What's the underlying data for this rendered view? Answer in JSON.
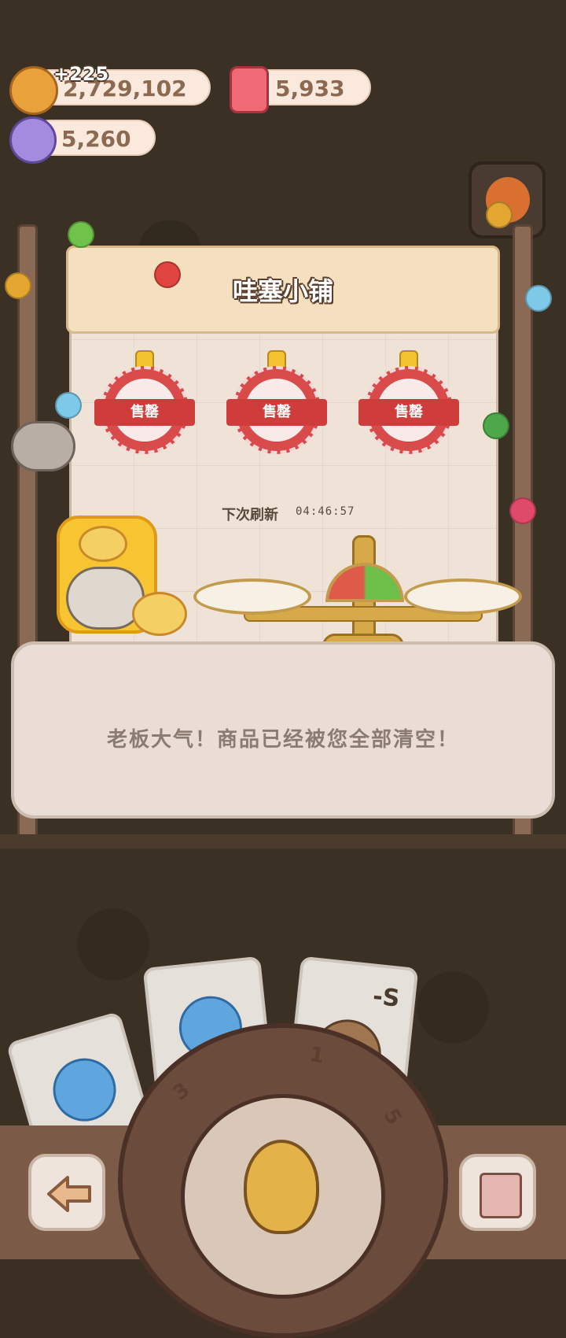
{
  "currencies": {
    "cookie": {
      "value": "2,729,102",
      "gain": "+225",
      "icon": "cookie-icon"
    },
    "candle": {
      "value": "5,933",
      "icon": "candle-icon"
    },
    "candy": {
      "value": "5,260",
      "icon": "candy-icon"
    }
  },
  "shop": {
    "title": "哇塞小铺",
    "slots": [
      {
        "status": "售罄"
      },
      {
        "status": "售罄"
      },
      {
        "status": "售罄"
      }
    ],
    "refresh_label": "下次刷新",
    "refresh_timer": "04:46:57"
  },
  "counter": {
    "message": "老板大气！商品已经被您全部清空！"
  },
  "dial": {
    "segments": [
      "3",
      "1",
      "5"
    ]
  },
  "card_label": "-S",
  "colors": {
    "stamp_red": "#d94b4b",
    "gauge_red": "#e05a4a",
    "gauge_green": "#6dbf4a",
    "pill_bg": "#fbe9dd"
  }
}
